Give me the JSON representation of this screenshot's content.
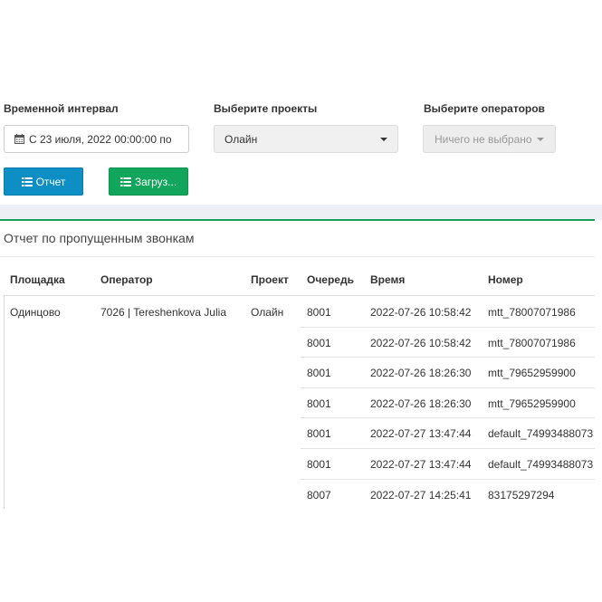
{
  "filters": {
    "interval_label": "Временной интервал",
    "interval_value": "С 23 июля, 2022 00:00:00 по",
    "projects_label": "Выберите проекты",
    "projects_value": "Олайн",
    "operators_label": "Выберите операторов",
    "operators_placeholder": "Ничего не выбрано"
  },
  "buttons": {
    "report": "Отчет",
    "download": "Загруз..."
  },
  "colors": {
    "report_button": "#0d8fc5",
    "download_button": "#11a65b",
    "accent_line": "#17a05d"
  },
  "report": {
    "title": "Отчет по пропущенным звонкам",
    "columns": [
      "Площадка",
      "Оператор",
      "Проект",
      "Очередь",
      "Время",
      "Номер"
    ],
    "group": {
      "site": "Одинцово",
      "operator": "7026 | Tereshenkova Julia",
      "project": "Олайн"
    },
    "rows": [
      {
        "queue": "8001",
        "time": "2022-07-26 10:58:42",
        "number": "mtt_78007071986"
      },
      {
        "queue": "8001",
        "time": "2022-07-26 10:58:42",
        "number": "mtt_78007071986"
      },
      {
        "queue": "8001",
        "time": "2022-07-26 18:26:30",
        "number": "mtt_79652959900"
      },
      {
        "queue": "8001",
        "time": "2022-07-26 18:26:30",
        "number": "mtt_79652959900"
      },
      {
        "queue": "8001",
        "time": "2022-07-27 13:47:44",
        "number": "default_74993488073"
      },
      {
        "queue": "8001",
        "time": "2022-07-27 13:47:44",
        "number": "default_74993488073"
      },
      {
        "queue": "8007",
        "time": "2022-07-27 14:25:41",
        "number": "83175297294"
      }
    ]
  }
}
